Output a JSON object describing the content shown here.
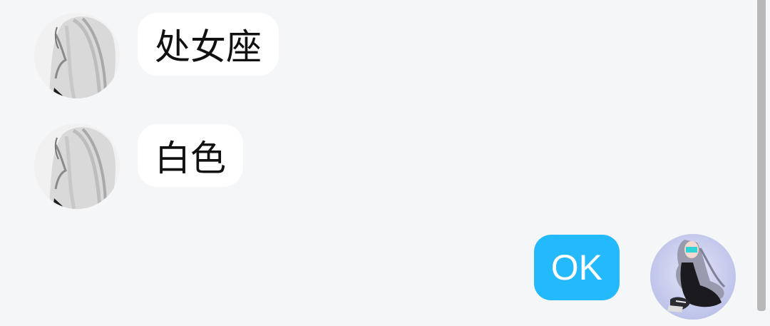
{
  "messages": [
    {
      "side": "left",
      "text": "处女座",
      "avatar_icon": "grey-haired-character-avatar"
    },
    {
      "side": "left",
      "text": "白色",
      "avatar_icon": "grey-haired-character-avatar"
    },
    {
      "side": "right",
      "text": "OK",
      "avatar_icon": "crouching-character-avatar"
    }
  ],
  "colors": {
    "background": "#f5f6f8",
    "incoming_bubble": "#ffffff",
    "outgoing_bubble": "#23b9fb",
    "scrollbar": "#b8b8b8"
  }
}
